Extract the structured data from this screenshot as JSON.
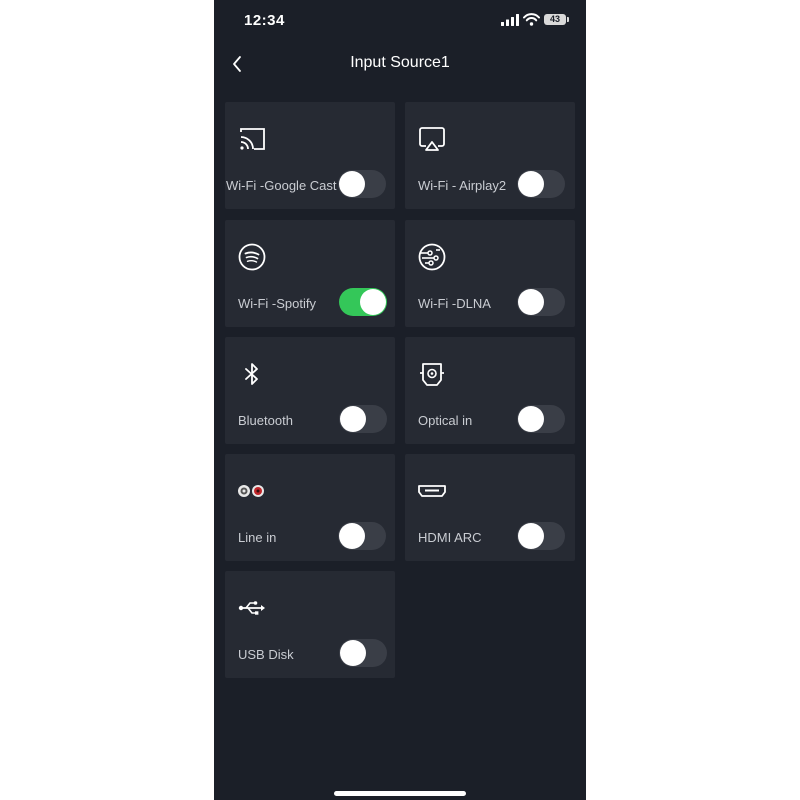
{
  "status_bar": {
    "time": "12:34",
    "battery": "43"
  },
  "header": {
    "title": "Input Source1"
  },
  "sources": [
    {
      "label": "Wi-Fi -Google Cast",
      "icon": "cast-icon",
      "enabled": false
    },
    {
      "label": "Wi-Fi - Airplay2",
      "icon": "airplay-icon",
      "enabled": false
    },
    {
      "label": "Wi-Fi -Spotify",
      "icon": "spotify-icon",
      "enabled": true
    },
    {
      "label": "Wi-Fi -DLNA",
      "icon": "dlna-icon",
      "enabled": false
    },
    {
      "label": "Bluetooth",
      "icon": "bluetooth-icon",
      "enabled": false
    },
    {
      "label": "Optical in",
      "icon": "optical-icon",
      "enabled": false
    },
    {
      "label": "Line in",
      "icon": "rca-line-in-icon",
      "enabled": false
    },
    {
      "label": "HDMI ARC",
      "icon": "hdmi-icon",
      "enabled": false
    },
    {
      "label": "USB Disk",
      "icon": "usb-icon",
      "enabled": false
    }
  ],
  "colors": {
    "background": "#1b1f28",
    "card": "#262a33",
    "toggle_on": "#34c759",
    "toggle_off": "#3a3e47"
  }
}
